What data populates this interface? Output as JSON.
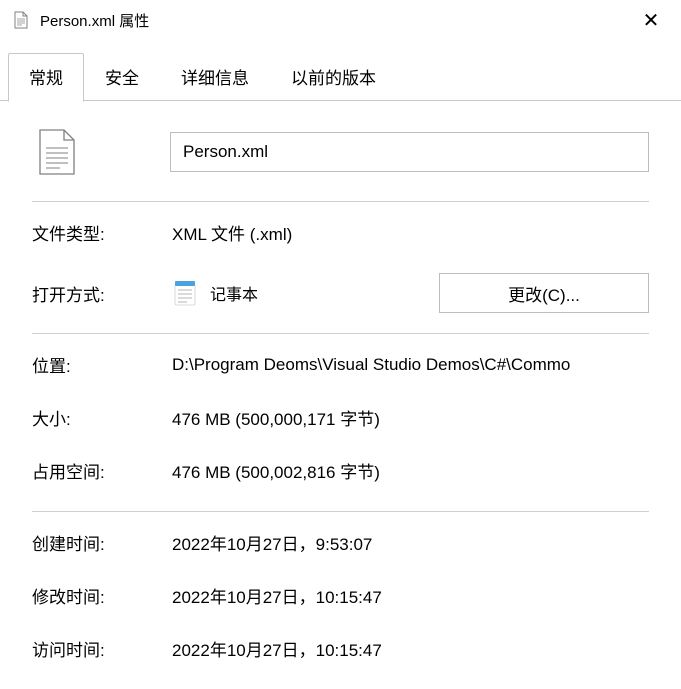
{
  "window": {
    "title": "Person.xml 属性"
  },
  "tabs": {
    "t0": "常规",
    "t1": "安全",
    "t2": "详细信息",
    "t3": "以前的版本"
  },
  "filename": "Person.xml",
  "fields": {
    "filetype_label": "文件类型:",
    "filetype_value": "XML 文件 (.xml)",
    "openwith_label": "打开方式:",
    "openwith_app": "记事本",
    "change_btn": "更改(C)...",
    "location_label": "位置:",
    "location_value": "D:\\Program Deoms\\Visual Studio Demos\\C#\\Commo",
    "size_label": "大小:",
    "size_value": "476 MB (500,000,171 字节)",
    "sizeondisk_label": "占用空间:",
    "sizeondisk_value": "476 MB (500,002,816 字节)",
    "created_label": "创建时间:",
    "created_value": "2022年10月27日，9:53:07",
    "modified_label": "修改时间:",
    "modified_value": "2022年10月27日，10:15:47",
    "accessed_label": "访问时间:",
    "accessed_value": "2022年10月27日，10:15:47"
  }
}
